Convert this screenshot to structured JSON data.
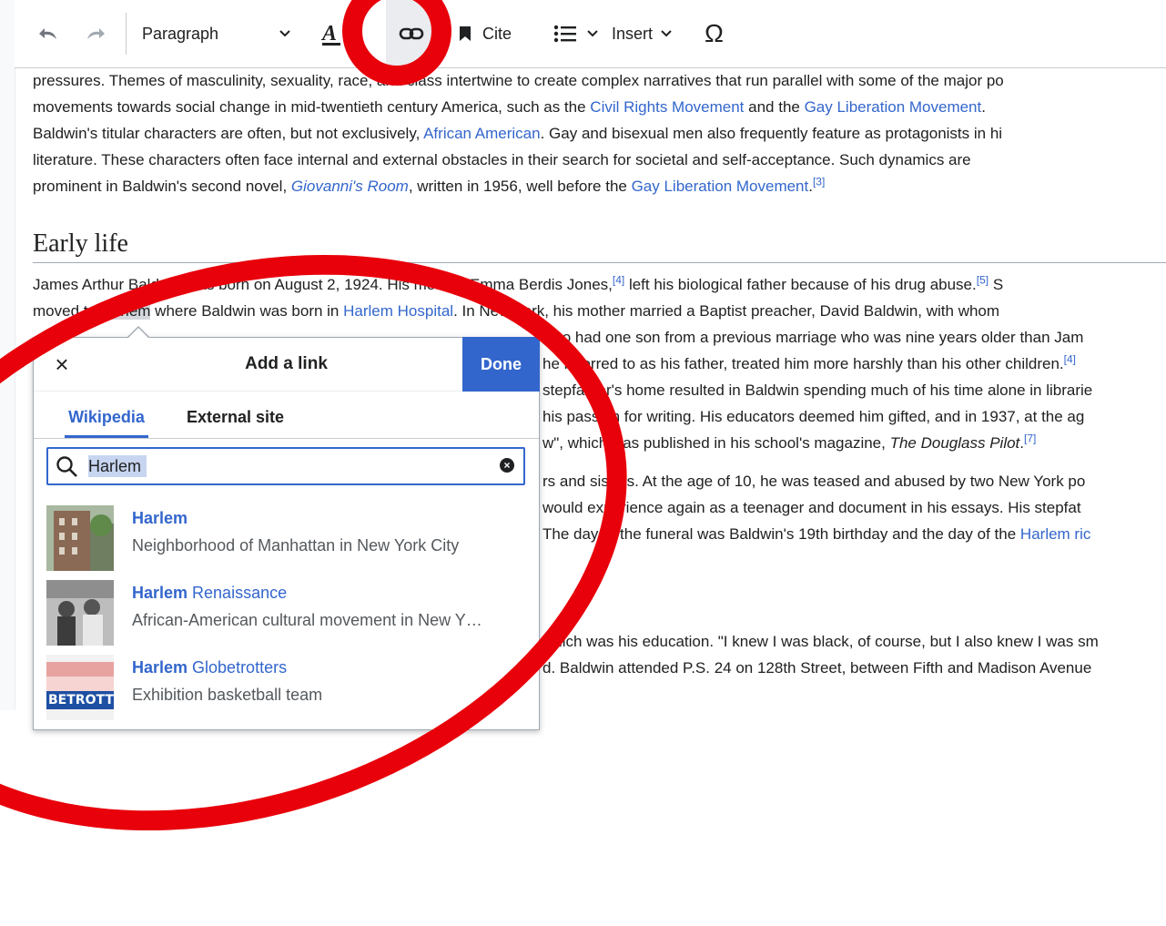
{
  "toolbar": {
    "paragraph_label": "Paragraph",
    "cite_label": "Cite",
    "insert_label": "Insert",
    "special_char": "Ω"
  },
  "article": {
    "intro_lines": [
      [
        "pressures. Themes of masculinity, sexuality, race, and class intertwine to create complex narratives that run parallel with some of the major po"
      ],
      [
        "movements towards social change in mid-twentieth century America, such as the ",
        "Civil Rights Movement",
        " and the ",
        "Gay Liberation Movement",
        "."
      ],
      [
        "Baldwin's titular characters are often, but not exclusively, ",
        "African American",
        ". Gay and bisexual men also frequently feature as protagonists in hi"
      ],
      [
        "literature. These characters often face internal and external obstacles in their search for societal and self-acceptance. Such dynamics are"
      ],
      [
        "prominent in Baldwin's second novel, ",
        "Giovanni's Room",
        ", written in 1956, well before the ",
        "Gay Liberation Movement",
        ".",
        "[3]"
      ]
    ],
    "heading": "Early life",
    "early_line1": [
      "James Arthur Baldwin was born on August 2, 1924. His mother, Emma Berdis Jones,",
      "[4]",
      " left his biological father because of his drug abuse.",
      "[5]",
      " S"
    ],
    "early_line2": [
      "moved to ",
      "Harlem",
      " where Baldwin was born in ",
      "Harlem Hospital",
      ". In New York, his mother married a Baptist preacher, David Baldwin, with whom"
    ],
    "right_lines": [
      "also had one son from a previous marriage who was nine years older than Jam",
      "he referred to as his father, treated him more harshly than his other children.",
      "stepfather's home resulted in Baldwin spending much of his time alone in librarie",
      "his passion for writing. His educators deemed him gifted, and in 1937, at the ag",
      "w\", which was published in his school's magazine, ",
      "rs and sisters. At the age of 10, he was teased and abused by two New York po",
      "would experience again as a teenager and document in his essays. His stepfat",
      "The day of the funeral was Baldwin's 19th birthday and the day of the ",
      "which was his education. \"I knew I was black, of course, but I also knew I was sm",
      "d. Baldwin attended P.S. 24 on 128th Street, between Fifth and Madison Avenue"
    ],
    "sup4": "[4]",
    "douglass": "The Douglass Pilot",
    "sup7": "[7]",
    "harlem_riot": "Harlem ric"
  },
  "dialog": {
    "close": "×",
    "title": "Add a link",
    "done": "Done",
    "tab_wikipedia": "Wikipedia",
    "tab_external": "External site",
    "search_value": "Harlem",
    "clear": "×",
    "results": [
      {
        "bold": "Harlem",
        "rest": "",
        "desc": "Neighborhood of Manhattan in New York City"
      },
      {
        "bold": "Harlem",
        "rest": " Renaissance",
        "desc": "African-American cultural movement in New Y…"
      },
      {
        "bold": "Harlem",
        "rest": " Globetrotters",
        "desc": "Exhibition basketball team"
      }
    ],
    "thumb3_text": "BETROTT"
  },
  "colors": {
    "link": "#3366cc",
    "annotation": "#e8000b",
    "done_bg": "#3366cc"
  }
}
